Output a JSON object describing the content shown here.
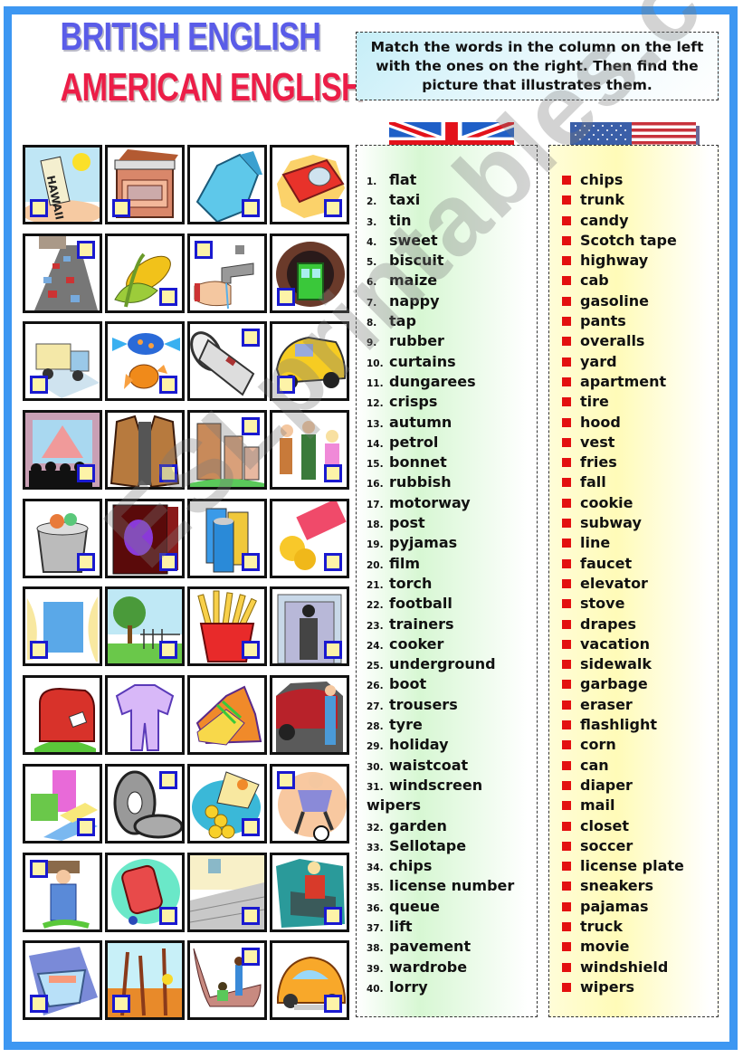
{
  "title": {
    "line1": "BRITISH ENGLISH",
    "line2": "AMERICAN ENGLISH"
  },
  "instructions": "Match the words in the column on the left with the ones on the right. Then find the picture that illustrates them.",
  "flags": {
    "british": "union-jack-flag",
    "american": "us-flag"
  },
  "british_words": [
    {
      "num": "1.",
      "word": "flat"
    },
    {
      "num": "2.",
      "word": "taxi"
    },
    {
      "num": "3.",
      "word": "tin"
    },
    {
      "num": "4.",
      "word": "sweet"
    },
    {
      "num": "5.",
      "word": "biscuit"
    },
    {
      "num": "6.",
      "word": "maize"
    },
    {
      "num": "7.",
      "word": "nappy"
    },
    {
      "num": "8.",
      "word": "tap"
    },
    {
      "num": "9.",
      "word": "rubber"
    },
    {
      "num": "10.",
      "word": "curtains"
    },
    {
      "num": "11.",
      "word": "dungarees"
    },
    {
      "num": "12.",
      "word": "crisps"
    },
    {
      "num": "13.",
      "word": "autumn"
    },
    {
      "num": "14.",
      "word": "petrol"
    },
    {
      "num": "15.",
      "word": "bonnet"
    },
    {
      "num": "16.",
      "word": "rubbish"
    },
    {
      "num": "17.",
      "word": "motorway"
    },
    {
      "num": "18.",
      "word": "post"
    },
    {
      "num": "19.",
      "word": "pyjamas"
    },
    {
      "num": "20.",
      "word": "film"
    },
    {
      "num": "21.",
      "word": "torch"
    },
    {
      "num": "22.",
      "word": "football"
    },
    {
      "num": "23.",
      "word": "trainers"
    },
    {
      "num": "24.",
      "word": "cooker"
    },
    {
      "num": "25.",
      "word": "underground"
    },
    {
      "num": "26.",
      "word": "boot"
    },
    {
      "num": "27.",
      "word": "trousers"
    },
    {
      "num": "28.",
      "word": "tyre"
    },
    {
      "num": "29.",
      "word": "holiday"
    },
    {
      "num": "30.",
      "word": "waistcoat"
    },
    {
      "num": "31.",
      "word": "windscreen",
      "continuation": "wipers"
    },
    {
      "num": "32.",
      "word": "garden"
    },
    {
      "num": "33.",
      "word": "Sellotape"
    },
    {
      "num": "34.",
      "word": "chips"
    },
    {
      "num": "35.",
      "word": "license number"
    },
    {
      "num": "36.",
      "word": "queue"
    },
    {
      "num": "37.",
      "word": "lift"
    },
    {
      "num": "38.",
      "word": "pavement"
    },
    {
      "num": "39.",
      "word": "wardrobe"
    },
    {
      "num": "40.",
      "word": "lorry"
    }
  ],
  "american_words": [
    "chips",
    "trunk",
    "candy",
    "Scotch tape",
    "highway",
    "cab",
    "gasoline",
    "pants",
    "overalls",
    "yard",
    "apartment",
    "tire",
    "hood",
    "vest",
    "fries",
    "fall",
    "cookie",
    "subway",
    "line",
    "faucet",
    "elevator",
    "stove",
    "drapes",
    "vacation",
    "sidewalk",
    "garbage",
    "eraser",
    "flashlight",
    "corn",
    "can",
    "diaper",
    "mail",
    "closet",
    "soccer",
    "license plate",
    "sneakers",
    "pajamas",
    "truck",
    "movie",
    "windshield",
    "wipers"
  ],
  "pictures": [
    {
      "name": "license-plate-picture",
      "checkbox": "bl"
    },
    {
      "name": "stove-picture",
      "checkbox": "bl"
    },
    {
      "name": "pants-picture",
      "checkbox": "br"
    },
    {
      "name": "scotch-tape-picture",
      "checkbox": "br"
    },
    {
      "name": "highway-picture",
      "checkbox": "tr"
    },
    {
      "name": "corn-picture",
      "checkbox": "br"
    },
    {
      "name": "faucet-picture",
      "checkbox": "tl"
    },
    {
      "name": "subway-picture",
      "checkbox": "bl"
    },
    {
      "name": "truck-picture",
      "checkbox": "bl"
    },
    {
      "name": "candy-picture",
      "checkbox": "br"
    },
    {
      "name": "flashlight-picture",
      "checkbox": "tr"
    },
    {
      "name": "cab-picture",
      "checkbox": "bl"
    },
    {
      "name": "movie-picture",
      "checkbox": "br"
    },
    {
      "name": "vest-picture",
      "checkbox": "br"
    },
    {
      "name": "apartment-picture",
      "checkbox": "tr"
    },
    {
      "name": "line-picture",
      "checkbox": "br"
    },
    {
      "name": "garbage-picture",
      "checkbox": "br"
    },
    {
      "name": "closet-picture",
      "checkbox": "br"
    },
    {
      "name": "can-picture",
      "checkbox": "br"
    },
    {
      "name": "chips-picture",
      "checkbox": "br"
    },
    {
      "name": "drapes-picture",
      "checkbox": "bl"
    },
    {
      "name": "yard-picture",
      "checkbox": "br"
    },
    {
      "name": "fries-picture",
      "checkbox": "br"
    },
    {
      "name": "elevator-picture",
      "checkbox": "br"
    },
    {
      "name": "mail-picture",
      "checkbox": "none"
    },
    {
      "name": "pajamas-picture",
      "checkbox": "none"
    },
    {
      "name": "sneakers-picture",
      "checkbox": "none"
    },
    {
      "name": "trunk-picture",
      "checkbox": "none"
    },
    {
      "name": "eraser-picture",
      "checkbox": "br"
    },
    {
      "name": "tire-picture",
      "checkbox": "tr"
    },
    {
      "name": "cookie-picture",
      "checkbox": "br"
    },
    {
      "name": "soccer-picture",
      "checkbox": "tl"
    },
    {
      "name": "overalls-picture",
      "checkbox": "tl"
    },
    {
      "name": "gasoline-picture",
      "checkbox": "br"
    },
    {
      "name": "sidewalk-picture",
      "checkbox": "br"
    },
    {
      "name": "hood-picture",
      "checkbox": "br"
    },
    {
      "name": "diaper-picture",
      "checkbox": "bl"
    },
    {
      "name": "fall-picture",
      "checkbox": "bl"
    },
    {
      "name": "vacation-picture",
      "checkbox": "tr"
    },
    {
      "name": "beetle-car-picture",
      "checkbox": "br"
    }
  ],
  "watermark": "ESLprintables.com",
  "colors": {
    "frame": "#3d97f2",
    "title_british": "#5a5ce8",
    "title_american": "#ec1d47",
    "bullet": "#e31010",
    "checkbox_border": "#1a1ad0",
    "checkbox_fill": "#fdf3a8"
  }
}
